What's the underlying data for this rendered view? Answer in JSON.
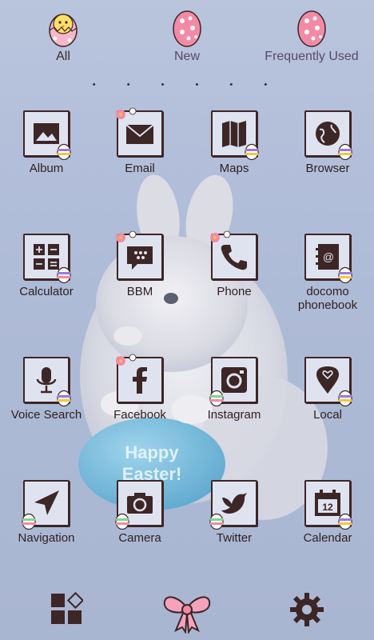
{
  "tabs": [
    {
      "label": "All",
      "active": true
    },
    {
      "label": "New",
      "active": false
    },
    {
      "label": "Frequently Used",
      "active": false
    }
  ],
  "page_indicator": "• • • • • •",
  "apps": [
    {
      "label": "Album",
      "icon": "image-icon"
    },
    {
      "label": "Email",
      "icon": "mail-icon"
    },
    {
      "label": "Maps",
      "icon": "map-icon"
    },
    {
      "label": "Browser",
      "icon": "globe-icon"
    },
    {
      "label": "Calculator",
      "icon": "calculator-icon"
    },
    {
      "label": "BBM",
      "icon": "chat-icon"
    },
    {
      "label": "Phone",
      "icon": "phone-icon"
    },
    {
      "label": "docomo\nphonebook",
      "icon": "address-book-icon"
    },
    {
      "label": "Voice Search",
      "icon": "microphone-icon"
    },
    {
      "label": "Facebook",
      "icon": "facebook-icon"
    },
    {
      "label": "Instagram",
      "icon": "camera-square-icon"
    },
    {
      "label": "Local",
      "icon": "map-pin-icon"
    },
    {
      "label": "Navigation",
      "icon": "navigation-arrow-icon"
    },
    {
      "label": "Camera",
      "icon": "camera-icon"
    },
    {
      "label": "Twitter",
      "icon": "bird-icon"
    },
    {
      "label": "Calendar",
      "icon": "calendar-icon"
    }
  ],
  "calendar_day": "12",
  "wallpaper_text": {
    "line1": "Happy",
    "line2": "Easter!"
  },
  "dock": {
    "left_icon": "widgets-icon",
    "center_icon": "bow-icon",
    "right_icon": "settings-gear-icon"
  },
  "colors": {
    "icon_border": "#3d2626",
    "egg_pink": "#f28aa6",
    "bow_pink": "#f4a3bd",
    "background": "#b9c4dd"
  }
}
